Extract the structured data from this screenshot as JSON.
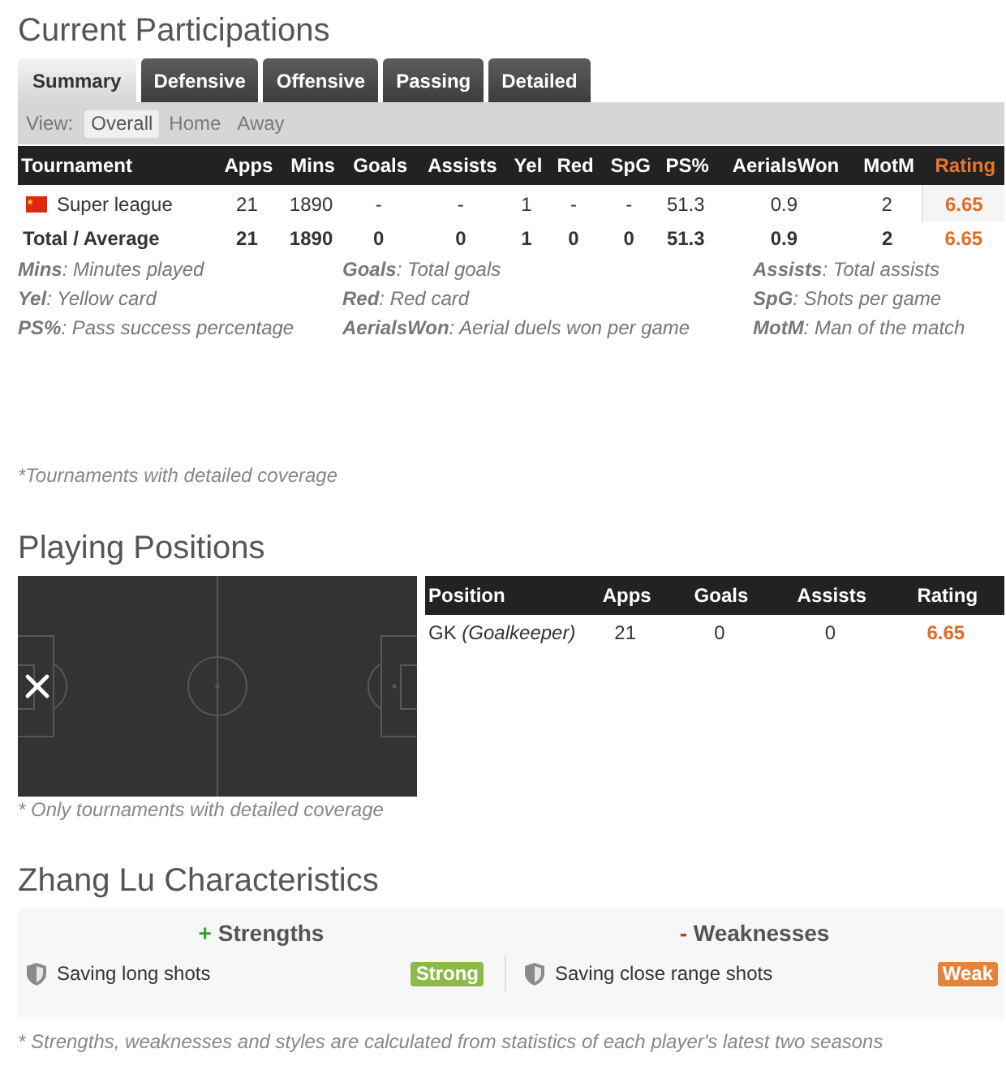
{
  "participations": {
    "title": "Current Participations",
    "tabs": [
      {
        "label": "Summary",
        "selected": true
      },
      {
        "label": "Defensive",
        "selected": false
      },
      {
        "label": "Offensive",
        "selected": false
      },
      {
        "label": "Passing",
        "selected": false
      },
      {
        "label": "Detailed",
        "selected": false
      }
    ],
    "view": {
      "label": "View:",
      "options": [
        {
          "label": "Overall",
          "selected": true
        },
        {
          "label": "Home",
          "selected": false
        },
        {
          "label": "Away",
          "selected": false
        }
      ]
    },
    "table": {
      "columns": [
        {
          "label": "Tournament",
          "kind": "text",
          "sorted": false
        },
        {
          "label": "Apps",
          "kind": "number",
          "sorted": false
        },
        {
          "label": "Mins",
          "kind": "number",
          "sorted": false
        },
        {
          "label": "Goals",
          "kind": "number",
          "sorted": false
        },
        {
          "label": "Assists",
          "kind": "number",
          "sorted": false
        },
        {
          "label": "Yel",
          "kind": "number",
          "sorted": false
        },
        {
          "label": "Red",
          "kind": "number",
          "sorted": false
        },
        {
          "label": "SpG",
          "kind": "number",
          "sorted": false
        },
        {
          "label": "PS%",
          "kind": "number",
          "sorted": false
        },
        {
          "label": "AerialsWon",
          "kind": "number",
          "sorted": false
        },
        {
          "label": "MotM",
          "kind": "number",
          "sorted": false
        },
        {
          "label": "Rating",
          "kind": "rating",
          "sorted": true
        }
      ],
      "rows": [
        {
          "kind": "tournament",
          "cells": [
            "Super league",
            "21",
            "1890",
            "-",
            "-",
            "1",
            "-",
            "-",
            "51.3",
            "0.9",
            "2",
            "6.65"
          ]
        },
        {
          "kind": "total",
          "cells": [
            "Total / Average",
            "21",
            "1890",
            "0",
            "0",
            "1",
            "0",
            "0",
            "51.3",
            "0.9",
            "2",
            "6.65"
          ]
        }
      ]
    },
    "legend": [
      "**Mins**: Minutes played",
      "**Goals**: Total goals",
      "**Assists**: Total assists",
      "**Yel**: Yellow card",
      "**Red**: Red card",
      "**SpG**: Shots per game",
      "**PS%**: Pass success percentage",
      "**AerialsWon**: Aerial duels won per game",
      "**MotM**: Man of the match"
    ],
    "footnote": "*Tournaments with detailed coverage"
  },
  "positions": {
    "title": "Playing Positions",
    "table": {
      "columns": [
        {
          "label": "Position",
          "kind": "text"
        },
        {
          "label": "Apps",
          "kind": "number"
        },
        {
          "label": "Goals",
          "kind": "number"
        },
        {
          "label": "Assists",
          "kind": "number"
        },
        {
          "label": "Rating",
          "kind": "rating"
        }
      ],
      "rows": [
        {
          "cells": [
            "GK *(Goalkeeper)*",
            "21",
            "0",
            "0",
            "6.65"
          ]
        }
      ]
    },
    "footnote": "* Only tournaments with detailed coverage"
  },
  "characteristics": {
    "title": "Zhang Lu Characteristics",
    "columns": [
      {
        "kind": "strengths",
        "sign": "+",
        "title": "Strengths",
        "items": [
          {
            "label": "Saving long shots",
            "badge": "Strong"
          }
        ]
      },
      {
        "kind": "weaknesses",
        "sign": "-",
        "title": "Weaknesses",
        "items": [
          {
            "label": "Saving close range shots",
            "badge": "Weak"
          }
        ]
      }
    ],
    "footnote": "* Strengths, weaknesses and styles are calculated from statistics of each player's latest two seasons"
  }
}
